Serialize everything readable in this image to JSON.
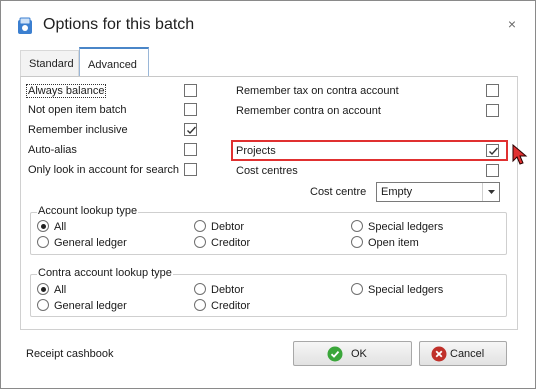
{
  "window": {
    "title": "Options for this batch",
    "close_glyph": "×",
    "accent": "#4a86c8"
  },
  "tabs": [
    {
      "label": "Standard",
      "active": false
    },
    {
      "label": "Advanced",
      "active": true
    }
  ],
  "left_options": [
    {
      "label": "Always balance",
      "checked": false
    },
    {
      "label": "Not open item batch",
      "checked": false
    },
    {
      "label": "Remember inclusive",
      "checked": true
    },
    {
      "label": "Auto-alias",
      "checked": false
    },
    {
      "label": "Only look in account for search",
      "checked": false
    }
  ],
  "right_options": [
    {
      "label": "Remember tax on contra account",
      "checked": false
    },
    {
      "label": "Remember contra on account",
      "checked": false
    },
    {
      "label": "Projects",
      "checked": true
    },
    {
      "label": "Cost centres",
      "checked": false
    }
  ],
  "cost_centre": {
    "label": "Cost centre",
    "value": "Empty"
  },
  "account_lookup": {
    "title": "Account lookup type",
    "options": [
      {
        "label": "All",
        "selected": true
      },
      {
        "label": "General ledger",
        "selected": false
      },
      {
        "label": "Debtor",
        "selected": false
      },
      {
        "label": "Creditor",
        "selected": false
      },
      {
        "label": "Special ledgers",
        "selected": false
      },
      {
        "label": "Open item",
        "selected": false
      }
    ]
  },
  "contra_lookup": {
    "title": "Contra account lookup type",
    "options": [
      {
        "label": "All",
        "selected": true
      },
      {
        "label": "General ledger",
        "selected": false
      },
      {
        "label": "Debtor",
        "selected": false
      },
      {
        "label": "Creditor",
        "selected": false
      },
      {
        "label": "Special ledgers",
        "selected": false
      }
    ]
  },
  "footer": {
    "label": "Receipt cashbook",
    "ok_label": "OK",
    "cancel_label": "Cancel",
    "ok_color": "#3aa63a",
    "cancel_color": "#c0302a"
  },
  "highlight_color": "#e03030"
}
